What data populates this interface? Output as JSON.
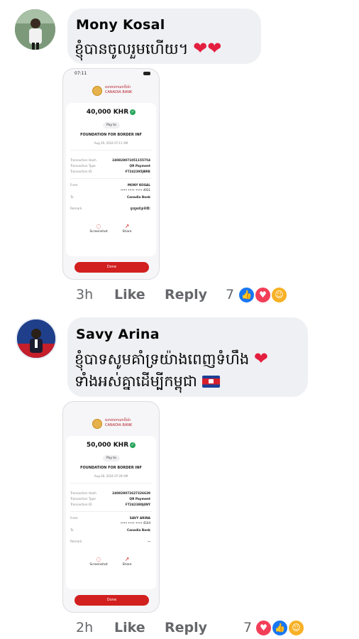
{
  "comments": [
    {
      "author": "Mony Kosal",
      "text": "ខ្ញុំបានចូលរួមហើយ។",
      "hearts": "❤❤",
      "receipt": {
        "status_time": "07:11",
        "bank_name_kh": "ធនាគារកាណាឌីយ៉ា",
        "bank_name_en": "CANADIA BANK",
        "amount": "40,000 KHR",
        "pay_to_label": "Pay to",
        "merchant": "FOUNDATION FOR BORDER INF",
        "date": "Aug 29, 2024 07:11 AM",
        "rows": [
          {
            "label": "Transaction Hash",
            "value": "240828071051155754"
          },
          {
            "label": "Transaction Type",
            "value": "QR Payment"
          },
          {
            "label": "Transaction ID",
            "value": "FT242395JBRK"
          }
        ],
        "from_label": "From",
        "from_name": "MONY KOSAL",
        "from_account": "•••• •••• •••• 4931",
        "to_label": "To",
        "to_value": "Canadia Bank",
        "remark_label": "Remark",
        "remark_value": "ចូលរួមគាំទ្រទ័ពវីរៈ",
        "screenshot_label": "Screenshot",
        "share_label": "Share",
        "done_label": "Done"
      },
      "time": "3h",
      "like_label": "Like",
      "reply_label": "Reply",
      "reaction_count": "7",
      "reactions": [
        "like",
        "love",
        "care"
      ]
    },
    {
      "author": "Savy Arina",
      "text_line1": "ខ្ញុំបាទសូមគាំទ្រយ៉ាងពេញទំហឹង",
      "text_line2": "ទាំងអស់គ្នាដើម្បីកម្ពុជា",
      "heart": "❤",
      "receipt": {
        "bank_name_kh": "ធនាគារកាណាឌីយ៉ា",
        "bank_name_en": "CANADIA BANK",
        "amount": "50,000 KHR",
        "pay_to_label": "Pay to",
        "merchant": "FOUNDATION FOR BORDER INF",
        "date": "Aug 28, 2024 07:28 AM",
        "rows": [
          {
            "label": "Transaction Hash",
            "value": "240828072627326639"
          },
          {
            "label": "Transaction Type",
            "value": "QR Payment"
          },
          {
            "label": "Transaction ID",
            "value": "FT242380J4NY"
          }
        ],
        "from_label": "From",
        "from_name": "SAVY ARINA",
        "from_account": "•••• •••• •••• 4104",
        "to_label": "To",
        "to_value": "Canadia Bank",
        "remark_label": "Remark",
        "remark_value": "--",
        "screenshot_label": "Screenshot",
        "share_label": "Share",
        "done_label": "Done"
      },
      "time": "2h",
      "like_label": "Like",
      "reply_label": "Reply",
      "reaction_count": "7",
      "reactions": [
        "love",
        "like",
        "care"
      ]
    }
  ],
  "colors": {
    "bubble": "#eef0f3",
    "meta_text": "#65676b",
    "done_button": "#d21f1f",
    "like_blue": "#1877f2",
    "love_red": "#f33e58"
  }
}
